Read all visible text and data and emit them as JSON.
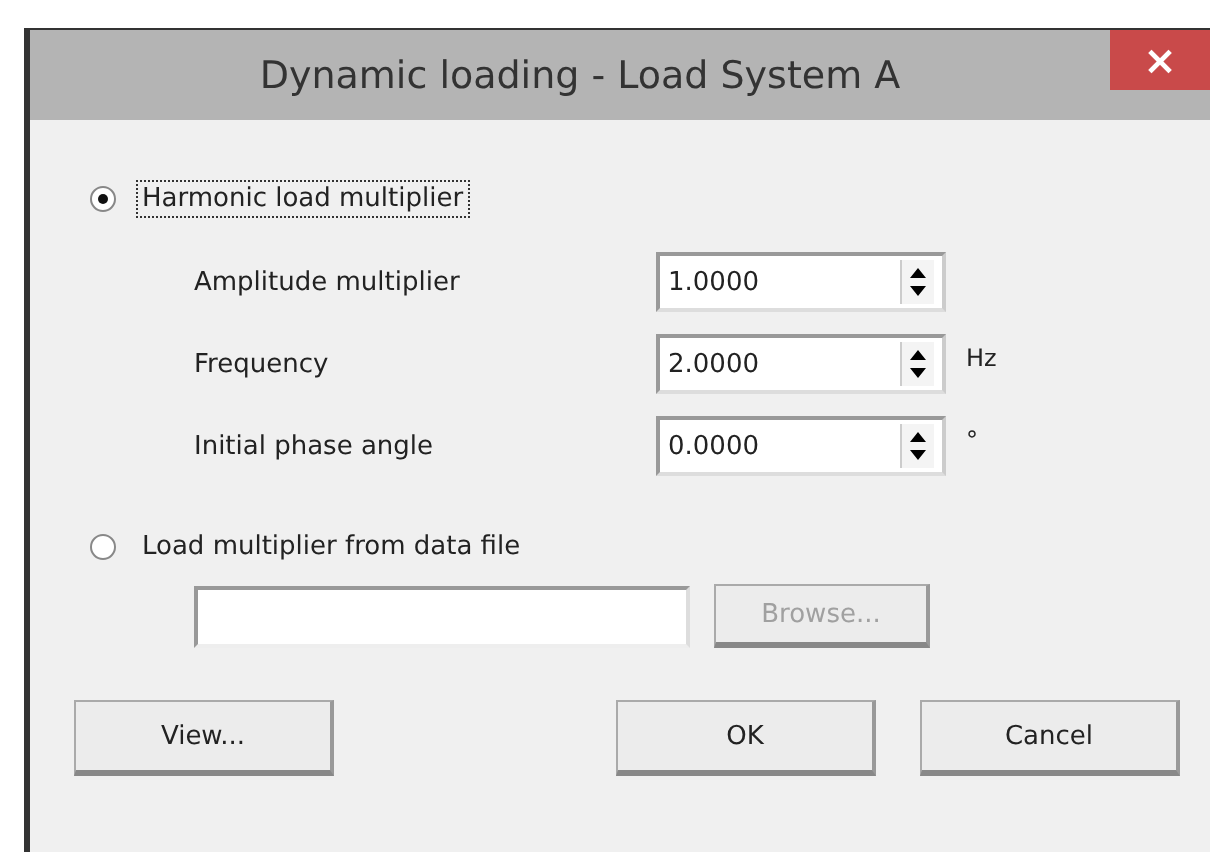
{
  "window": {
    "title": "Dynamic loading - Load System A",
    "close": "×"
  },
  "options": [
    {
      "label": "Harmonic load multiplier",
      "selected": true,
      "focused": true
    },
    {
      "label": "Load multiplier from data file",
      "selected": false,
      "focused": false
    }
  ],
  "harmonic_fields": [
    {
      "label": "Amplitude multiplier",
      "value": "1.0000"
    },
    {
      "label": "Frequency",
      "value": "2.0000",
      "unit": "Hz"
    },
    {
      "label": "Initial phase angle",
      "value": "0.0000",
      "unit": "°"
    }
  ],
  "file": {
    "browse": {
      "label": "Browse...",
      "disabled": true
    }
  },
  "buttons": [
    {
      "label": "View..."
    },
    {
      "label": "OK"
    },
    {
      "label": "Cancel"
    }
  ]
}
